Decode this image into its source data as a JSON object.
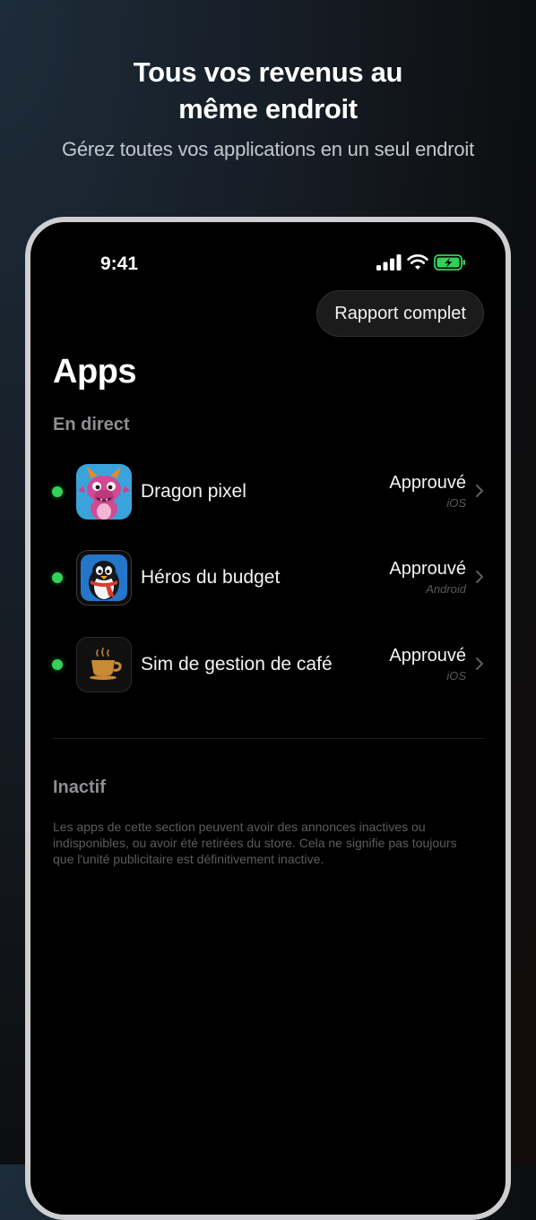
{
  "promo": {
    "headline_line1": "Tous vos revenus au",
    "headline_line2": "même endroit",
    "subheadline": "Gérez toutes vos applications en un seul endroit"
  },
  "status_bar": {
    "time": "9:41",
    "icons": [
      "cellular-signal-icon",
      "wifi-icon",
      "battery-charging-icon"
    ],
    "battery_color": "#34d158"
  },
  "header": {
    "report_button": "Rapport complet",
    "title": "Apps"
  },
  "live_section": {
    "title": "En direct",
    "apps": [
      {
        "name": "Dragon pixel",
        "status": "Approuvé",
        "platform": "iOS",
        "icon": "dragon-app-icon",
        "status_dot_color": "#34d158"
      },
      {
        "name": "Héros du budget",
        "status": "Approuvé",
        "platform": "Android",
        "icon": "penguin-app-icon",
        "status_dot_color": "#34d158"
      },
      {
        "name": "Sim de gestion de café",
        "status": "Approuvé",
        "platform": "iOS",
        "icon": "coffee-cup-app-icon",
        "status_dot_color": "#34d158"
      }
    ]
  },
  "inactive_section": {
    "title": "Inactif",
    "note": "Les apps de cette section peuvent avoir des annonces inactives ou indisponibles, ou avoir été retirées du store. Cela ne signifie pas toujours que l'unité publicitaire est définitivement inactive."
  }
}
